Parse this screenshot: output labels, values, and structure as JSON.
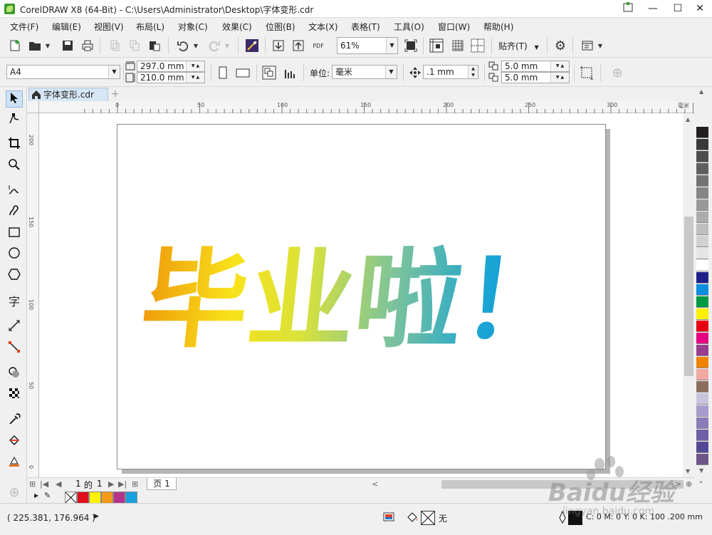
{
  "window": {
    "title": "CorelDRAW X8 (64-Bit) - C:\\Users\\Administrator\\Desktop\\字体变形.cdr",
    "minimize": "—",
    "maximize": "☐",
    "close": "✕"
  },
  "menu": [
    "文件(F)",
    "编辑(E)",
    "视图(V)",
    "布局(L)",
    "对象(C)",
    "效果(C)",
    "位图(B)",
    "文本(X)",
    "表格(T)",
    "工具(O)",
    "窗口(W)",
    "帮助(H)"
  ],
  "toolbar": {
    "zoom": "61%",
    "pdf_label": "PDF",
    "snap_label": "贴齐(T)"
  },
  "property_bar": {
    "page_size": "A4",
    "width": "297.0 mm",
    "height": "210.0 mm",
    "unit_label": "单位:",
    "unit": "毫米",
    "nudge": ".1 mm",
    "dup_x": "5.0 mm",
    "dup_y": "5.0 mm"
  },
  "doc_tab": "字体变形.cdr",
  "ruler": {
    "h_labels": [
      "0",
      "50",
      "100",
      "150",
      "200",
      "250",
      "300"
    ],
    "h_unit": "毫米",
    "v_labels": [
      "200",
      "150",
      "100",
      "50",
      "0"
    ]
  },
  "artwork": {
    "text": "毕业啦！",
    "gradient": [
      "#ef9a0a",
      "#f8e21a",
      "#d9e23a",
      "#7cc39b",
      "#1aa4d3",
      "#0e8fe6"
    ]
  },
  "page_nav": {
    "current": "1",
    "of": "的",
    "total": "1",
    "page_tab": "页 1"
  },
  "doc_palette_colors": [
    "#e00d1e",
    "#fff200",
    "#f39a18",
    "#b5338a",
    "#1aa0e0"
  ],
  "palette_colors": [
    "#231f20",
    "#3a3a3a",
    "#4d4d4d",
    "#606060",
    "#737373",
    "#868686",
    "#999999",
    "#acacac",
    "#bfbfbf",
    "#d2d2d2",
    "#e5e5e5",
    "#ffffff",
    "#1d2088",
    "#0b8de0",
    "#009944",
    "#fff100",
    "#e60012",
    "#e4007f",
    "#9a3e8d",
    "#f08300",
    "#f1a8a2",
    "#8c6e5e",
    "#c9c3dd",
    "#a79ccb",
    "#8b7cb9",
    "#6e5fa6",
    "#534896",
    "#6d5588"
  ],
  "status": {
    "coords": "( 225.381, 176.964 )",
    "fill_none": "无",
    "outline": "C: 0 M: 0 Y: 0 K: 100  .200 mm"
  },
  "watermark": {
    "brand": "Baidu经验",
    "url": "jingyan.baidu.com"
  }
}
